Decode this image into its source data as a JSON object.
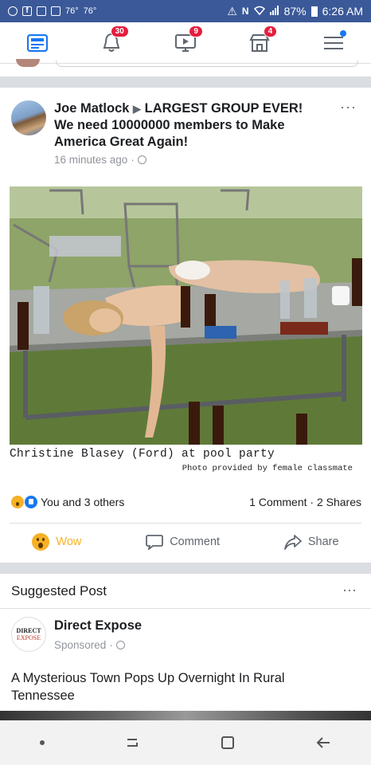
{
  "status_bar": {
    "temps": [
      "76°",
      "76°"
    ],
    "battery": "87%",
    "time": "6:26 AM"
  },
  "nav": {
    "items": [
      {
        "name": "news-feed",
        "badge": ""
      },
      {
        "name": "notifications",
        "badge": "30"
      },
      {
        "name": "watch",
        "badge": "9"
      },
      {
        "name": "marketplace",
        "badge": "4"
      },
      {
        "name": "menu",
        "badge": ""
      }
    ]
  },
  "post": {
    "author": "Joe Matlock",
    "group": "LARGEST GROUP EVER! We need 10000000 members to Make America Great Again!",
    "time": "16 minutes ago",
    "more": "···",
    "caption_main": "Christine Blasey (Ford) at pool party",
    "caption_sub": "Photo provided by female classmate",
    "reactions_text": "You and 3 others",
    "counts_text": "1 Comment · 2 Shares",
    "actions": {
      "wow": "Wow",
      "comment": "Comment",
      "share": "Share"
    }
  },
  "suggested": {
    "title": "Suggested Post",
    "more": "···",
    "advertiser": "Direct Expose",
    "logo_line1": "DIRECT",
    "logo_line2": "EXPOSE",
    "sponsored": "Sponsored",
    "headline": "A Mysterious Town Pops Up Overnight In Rural Tennessee"
  },
  "colors": {
    "status_bar": "#3b5998",
    "badge": "#e41e3f",
    "accent": "#1877f2",
    "wow": "#f7b125"
  }
}
